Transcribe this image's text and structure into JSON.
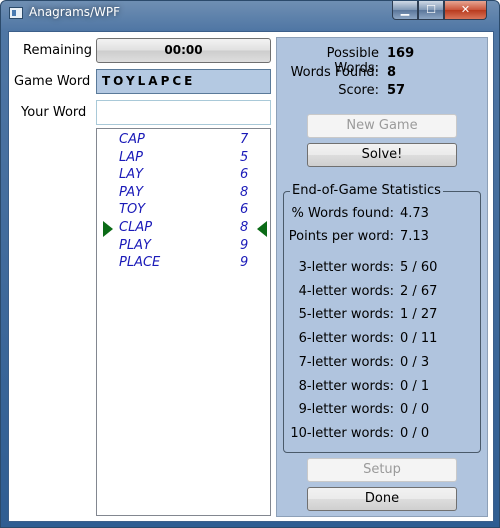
{
  "window": {
    "title": "Anagrams/WPF",
    "minimize_glyph": "▁",
    "maximize_glyph": "☐",
    "close_glyph": "✕"
  },
  "left": {
    "remaining_label": "Remaining",
    "timer_value": "00:00",
    "game_word_label": "Game Word",
    "game_word": "TOYLAPCE",
    "your_word_label": "Your Word",
    "your_word_value": ""
  },
  "words": [
    {
      "word": "CAP",
      "score": "7"
    },
    {
      "word": "LAP",
      "score": "5"
    },
    {
      "word": "LAY",
      "score": "6"
    },
    {
      "word": "PAY",
      "score": "8"
    },
    {
      "word": "TOY",
      "score": "6"
    },
    {
      "word": "CLAP",
      "score": "8",
      "selected": true
    },
    {
      "word": "PLAY",
      "score": "9"
    },
    {
      "word": "PLACE",
      "score": "9"
    }
  ],
  "summary": {
    "possible_label": "Possible Words:",
    "possible_value": "169",
    "found_label": "Words Found:",
    "found_value": "8",
    "score_label": "Score:",
    "score_value": "57"
  },
  "buttons": {
    "new_game": "New Game",
    "solve": "Solve!",
    "setup": "Setup",
    "done": "Done"
  },
  "stats": {
    "title": "End-of-Game Statistics",
    "pct_label": "% Words found:",
    "pct_value": "4.73",
    "ppw_label": "Points per word:",
    "ppw_value": "7.13",
    "letters": [
      {
        "label": "3-letter words:",
        "value": "5 / 60"
      },
      {
        "label": "4-letter words:",
        "value": "2 / 67"
      },
      {
        "label": "5-letter words:",
        "value": "1 / 27"
      },
      {
        "label": "6-letter words:",
        "value": "0 / 11"
      },
      {
        "label": "7-letter words:",
        "value": "0 / 3"
      },
      {
        "label": "8-letter words:",
        "value": "0 / 1"
      },
      {
        "label": "9-letter words:",
        "value": "0 / 0"
      },
      {
        "label": "10-letter words:",
        "value": "0 / 0"
      }
    ]
  }
}
